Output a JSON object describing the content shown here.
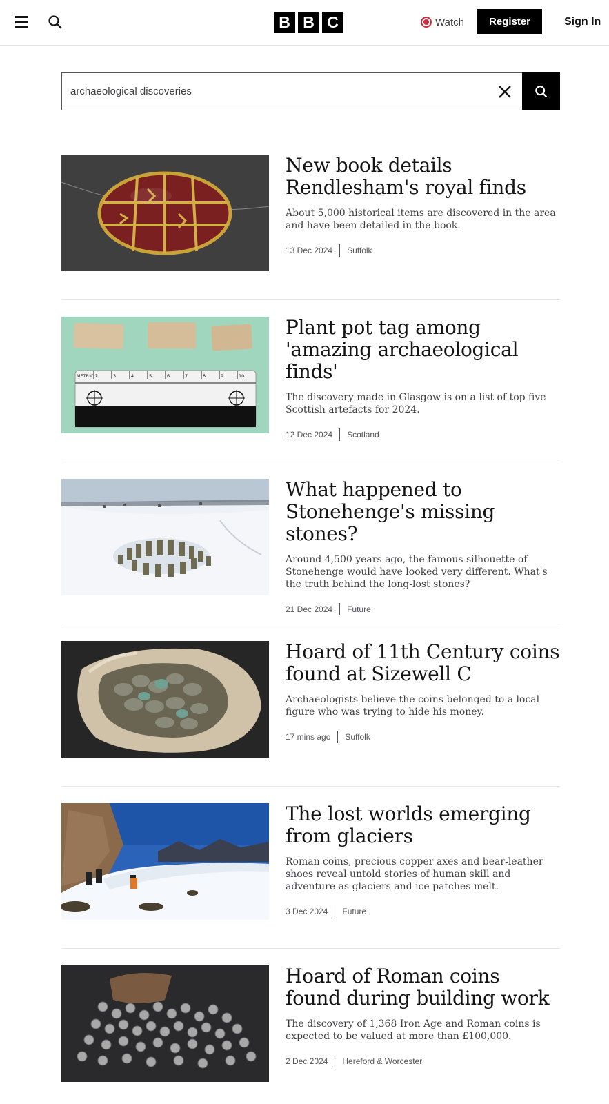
{
  "header": {
    "logo_letters": [
      "B",
      "B",
      "C"
    ],
    "watch_label": "Watch",
    "register_label": "Register",
    "signin_label": "Sign In"
  },
  "search": {
    "value": "archaeological discoveries"
  },
  "results": [
    {
      "title": "New book details Rendlesham's royal finds",
      "summary": "About 5,000 historical items are discovered in the area and have been detailed in the book.",
      "date": "13 Dec 2024",
      "section": "Suffolk",
      "image": "gold-garnet-bead-image"
    },
    {
      "title": "Plant pot tag among 'amazing archaeological finds'",
      "summary": "The discovery made in Glasgow is on a list of top five Scottish artefacts for 2024.",
      "date": "12 Dec 2024",
      "section": "Scotland",
      "image": "plant-pot-tag-with-scale-image",
      "scale_labels": [
        "METRIC 1",
        "2",
        "3",
        "4",
        "5",
        "6",
        "7",
        "8",
        "9",
        "10"
      ]
    },
    {
      "title": "What happened to Stonehenge's missing stones?",
      "summary": "Around 4,500 years ago, the famous silhouette of Stonehenge would have looked very different. What's the truth behind the long-lost stones?",
      "date": "21 Dec 2024",
      "section": "Future",
      "image": "snowy-stonehenge-aerial-image"
    },
    {
      "title": "Hoard of 11th Century coins found at Sizewell C",
      "summary": "Archaeologists believe the coins belonged to a local figure who was trying to hide his money.",
      "date": "17 mins ago",
      "section": "Suffolk",
      "image": "coin-hoard-in-clay-image"
    },
    {
      "title": "The lost worlds emerging from glaciers",
      "summary": "Roman coins, precious copper axes and bear-leather shoes reveal untold stories of human skill and adventure as glaciers and ice patches melt.",
      "date": "3 Dec 2024",
      "section": "Future",
      "image": "glacier-excavation-image"
    },
    {
      "title": "Hoard of Roman coins found during building work",
      "summary": "The discovery of 1,368 Iron Age and Roman coins is expected to be valued at more than £100,000.",
      "date": "2 Dec 2024",
      "section": "Hereford & Worcester",
      "image": "roman-silver-coins-image"
    }
  ],
  "colors": {
    "accent_red": "#d42a3c",
    "text": "#141414",
    "muted": "#545658",
    "divider": "#e6e6e6"
  }
}
